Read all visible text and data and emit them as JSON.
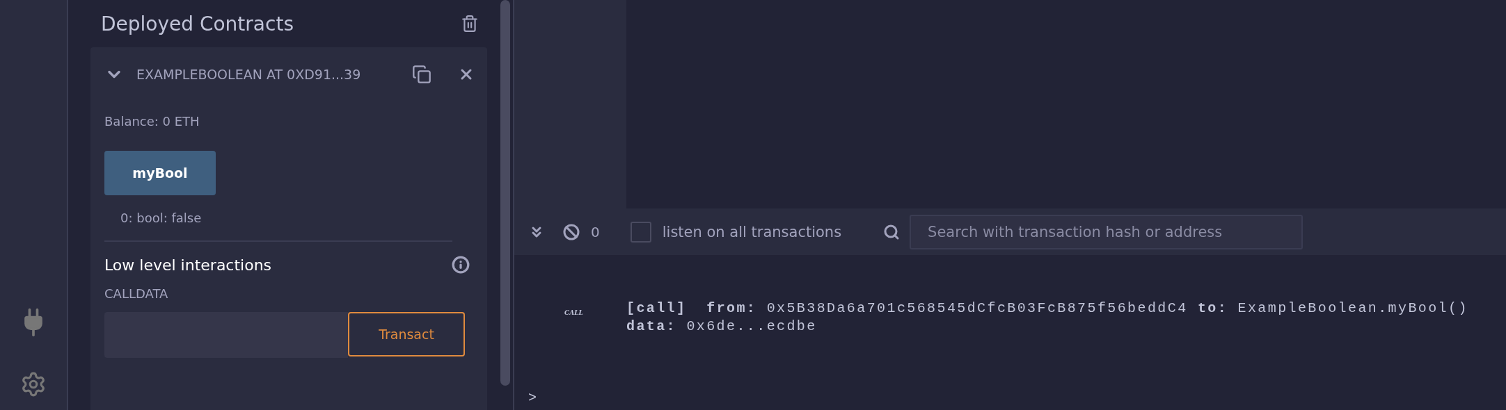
{
  "panel": {
    "title": "Deployed Contracts",
    "contract": {
      "expanded": true,
      "title": "EXAMPLEBOOLEAN AT 0XD91...39",
      "balance": "Balance: 0 ETH",
      "functions": [
        {
          "label": "myBool",
          "output": "0: bool: false"
        }
      ],
      "low_level": {
        "title": "Low level interactions",
        "calldata_label": "CALLDATA",
        "button": "Transact"
      }
    }
  },
  "console": {
    "count": "0",
    "listen": {
      "label": "listen on all transactions",
      "checked": false
    },
    "search": {
      "placeholder": "Search with transaction hash or address"
    },
    "logs": [
      {
        "type": "CALL",
        "lines": [
          "**[call]**  **from:** 0x5B38Da6a701c568545dCfcB03FcB875f56beddC4 **to:** ExampleBoolean.myBool()",
          "**data:** 0x6de...ecdbe"
        ]
      }
    ],
    "prompt": ">"
  }
}
